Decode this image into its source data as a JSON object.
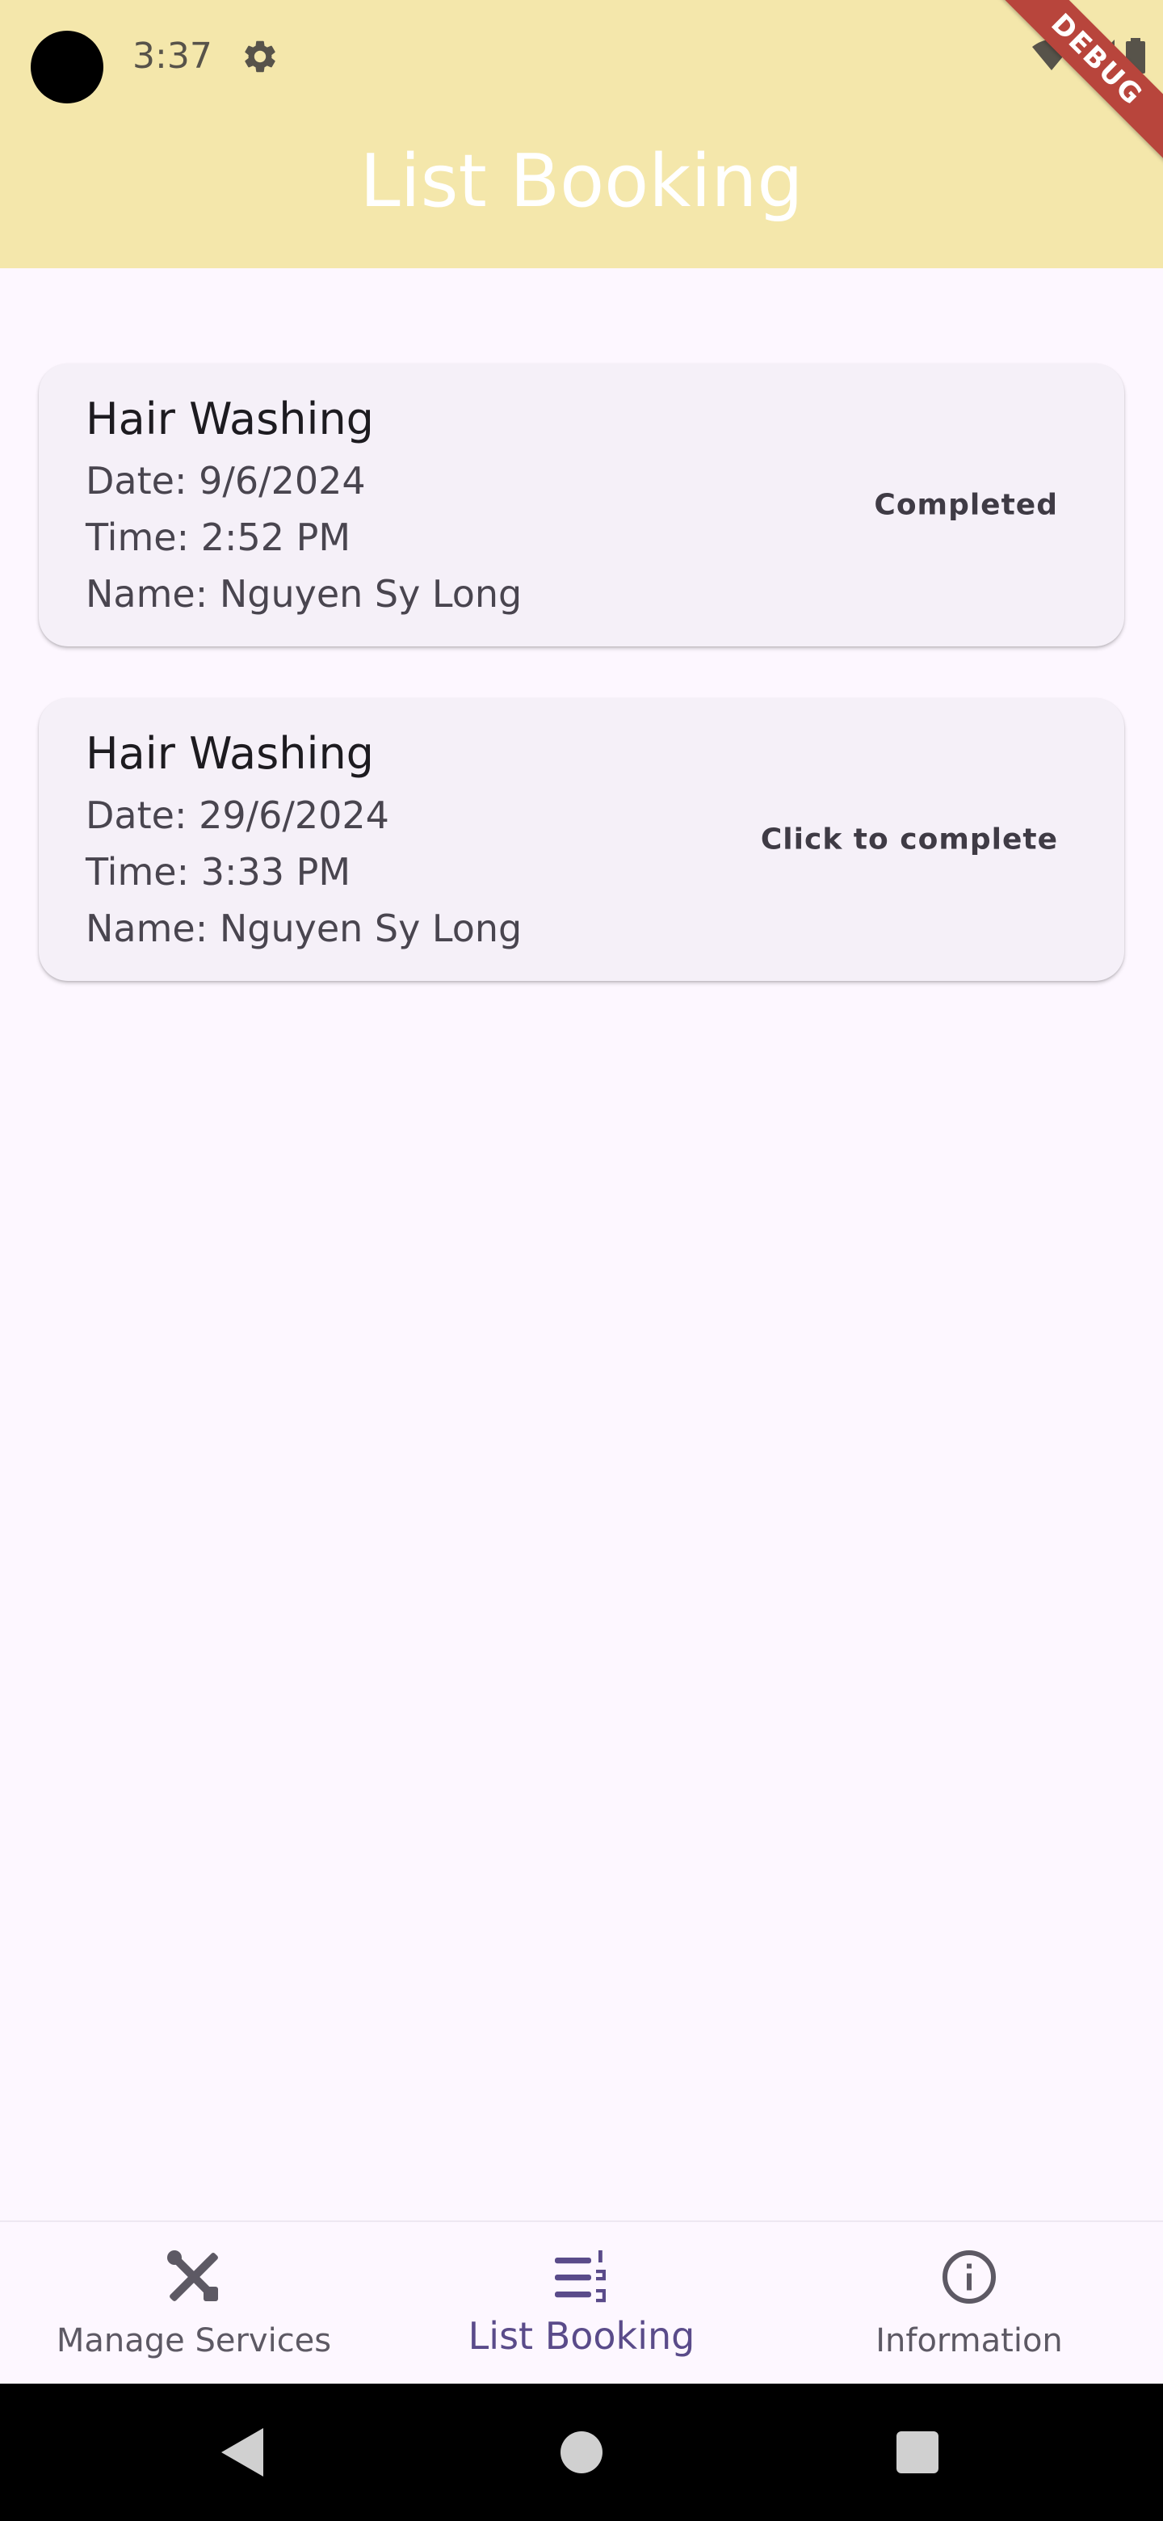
{
  "status_bar": {
    "time": "3:37"
  },
  "debug_banner": "DEBUG",
  "app_bar": {
    "title": "List Booking"
  },
  "bookings": [
    {
      "service": "Hair Washing",
      "date": "Date: 9/6/2024",
      "time": "Time: 2:52 PM",
      "name": "Name: Nguyen Sy Long",
      "action": "Completed"
    },
    {
      "service": "Hair Washing",
      "date": "Date: 29/6/2024",
      "time": "Time: 3:33 PM",
      "name": "Name: Nguyen Sy Long",
      "action": "Click to complete"
    }
  ],
  "bottom_nav": {
    "items": [
      {
        "label": "Manage Services",
        "icon": "tools-icon",
        "active": false
      },
      {
        "label": "List Booking",
        "icon": "format-list-numbered-icon",
        "active": true
      },
      {
        "label": "Information",
        "icon": "info-icon",
        "active": false
      }
    ]
  },
  "colors": {
    "app_bar": "#f4e7ab",
    "background": "#fdf7ff",
    "card": "#f5f0f8",
    "active_nav": "#5a4b8a",
    "debug_banner": "#b8453c"
  }
}
